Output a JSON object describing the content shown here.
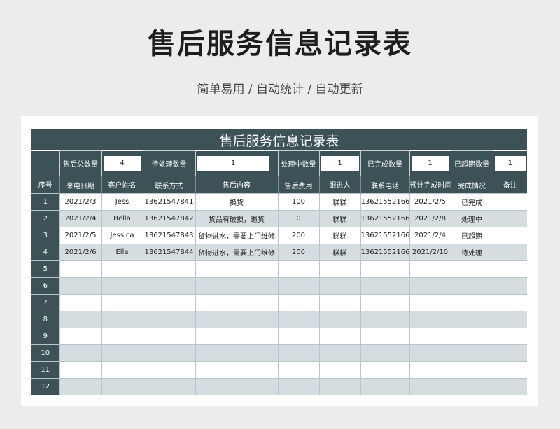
{
  "page": {
    "title": "售后服务信息记录表",
    "subtitle": "简单易用 / 自动统计 / 自动更新"
  },
  "sheet": {
    "title": "售后服务信息记录表",
    "summary": [
      {
        "label": "售后总数量",
        "value": "4"
      },
      {
        "label": "待处理数量",
        "value": "1"
      },
      {
        "label": "处理中数量",
        "value": "1"
      },
      {
        "label": "已完成数量",
        "value": "1"
      },
      {
        "label": "已超期数量",
        "value": "1"
      }
    ],
    "columns": [
      "序号",
      "来电日期",
      "客户姓名",
      "联系方式",
      "售后内容",
      "售后费用",
      "跟进人",
      "联系电话",
      "预计完成时间",
      "完成情况",
      "备注"
    ],
    "rows": [
      [
        "1",
        "2021/2/3",
        "Jess",
        "13621547841",
        "换货",
        "100",
        "糕糕",
        "13621552166",
        "2021/2/5",
        "已完成",
        ""
      ],
      [
        "2",
        "2021/2/4",
        "Bella",
        "13621547842",
        "货品有破损，退货",
        "0",
        "糕糕",
        "13621552166",
        "2021/2/8",
        "处理中",
        ""
      ],
      [
        "3",
        "2021/2/5",
        "Jessica",
        "13621547843",
        "货物进水，需要上门维修",
        "200",
        "糕糕",
        "13621552166",
        "2021/2/4",
        "已超期",
        ""
      ],
      [
        "4",
        "2021/2/6",
        "Ella",
        "13621547844",
        "货物进水，需要上门维修",
        "200",
        "糕糕",
        "13621552166",
        "2021/2/10",
        "待处理",
        ""
      ],
      [
        "5",
        "",
        "",
        "",
        "",
        "",
        "",
        "",
        "",
        "",
        ""
      ],
      [
        "6",
        "",
        "",
        "",
        "",
        "",
        "",
        "",
        "",
        "",
        ""
      ],
      [
        "7",
        "",
        "",
        "",
        "",
        "",
        "",
        "",
        "",
        "",
        ""
      ],
      [
        "8",
        "",
        "",
        "",
        "",
        "",
        "",
        "",
        "",
        "",
        ""
      ],
      [
        "9",
        "",
        "",
        "",
        "",
        "",
        "",
        "",
        "",
        "",
        ""
      ],
      [
        "10",
        "",
        "",
        "",
        "",
        "",
        "",
        "",
        "",
        "",
        ""
      ],
      [
        "11",
        "",
        "",
        "",
        "",
        "",
        "",
        "",
        "",
        "",
        ""
      ],
      [
        "12",
        "",
        "",
        "",
        "",
        "",
        "",
        "",
        "",
        "",
        ""
      ]
    ]
  }
}
